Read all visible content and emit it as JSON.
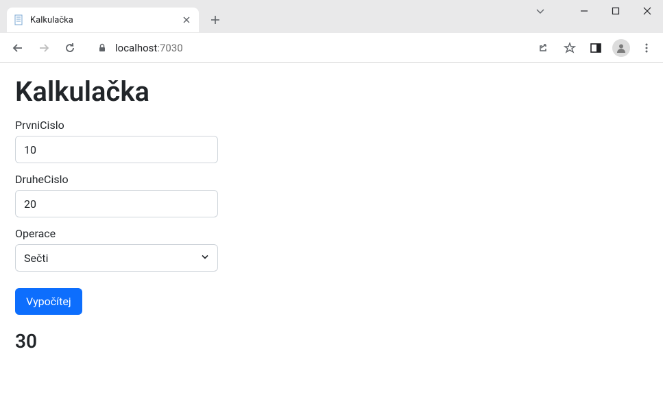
{
  "browser": {
    "tab_title": "Kalkulačka",
    "url_host": "localhost",
    "url_port": ":7030"
  },
  "page": {
    "heading": "Kalkulačka",
    "labels": {
      "first_number": "PrvniCislo",
      "second_number": "DruheCislo",
      "operation": "Operace"
    },
    "values": {
      "first_number": "10",
      "second_number": "20",
      "operation_selected": "Sečti"
    },
    "submit_label": "Vypočítej",
    "result": "30"
  }
}
